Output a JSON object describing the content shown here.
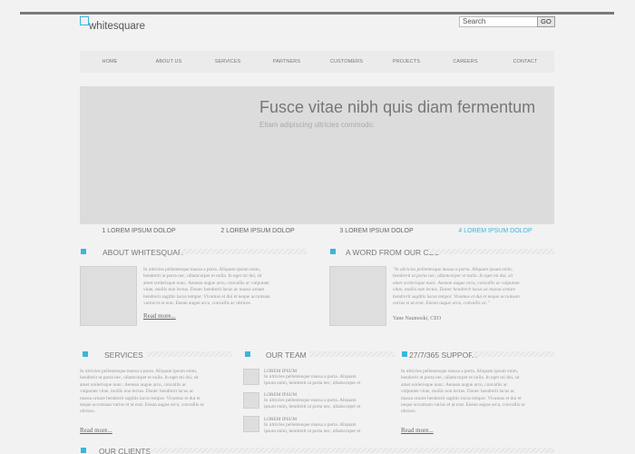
{
  "brand": {
    "logo_text": "whitesquare",
    "accent": "#3ab6dc"
  },
  "search": {
    "value": "Search",
    "button": "GO"
  },
  "nav": [
    "HOME",
    "ABOUT US",
    "SERVICES",
    "PARTNERS",
    "CUSTOMERS",
    "PROJECTS",
    "CAREERS",
    "CONTACT"
  ],
  "hero": {
    "title": "Fusce vitae nibh quis diam fermentum",
    "subtitle": "Etiam adipiscing ultricies commodo."
  },
  "slider_tabs": [
    "1 LOREM IPSUM DOLOP",
    "2 LOREM IPSUM DOLOP",
    "3 LOREM IPSUM DOLOP",
    "4 LOREM IPSUM DOLOP"
  ],
  "about": {
    "title": "ABOUT WHITESQUAR",
    "lines": [
      "In ultricies pellentesque massa a porta. Aliquam ipsum enim,",
      "hendrerit ut porta nec, ullamcorper et nulla. In eget mi dui, sit",
      "amet scelerisque nunc. Aenean augue arcu, convallis ac vulputate",
      "vitae, mollis non lectus. Donec hendrerit lacus ac massa ornare",
      "hendrerit sagittis lacus tempor. Vivamus et dui et neque accumsan",
      "varius et ut erat. Enean augue arcu, convallis ac ultrices."
    ],
    "read_more": "Read more..."
  },
  "ceo": {
    "title": "A WORD FROM OUR CEO",
    "lines": [
      "\"In ultricies pellentesque massa a porta. Aliquam ipsum enim,",
      "hendrerit ut porta nec, ullamcorper et nulla. In eget mi dui, sit",
      "amet scelerisque nunc. Aenean augue arcu, convallis ac vulputate",
      "vitae, mollis non lectus. Donec hendrerit lacus ac massa ornare",
      "hendrerit sagittis lacus tempor. Vivamus et dui et neque accumsan",
      "varius et ut erat. Enean augue arcu, convallis ac.\""
    ],
    "author": "Yane Naumoski, CEO"
  },
  "services": {
    "title": "SERVICES",
    "lines": [
      "In ultricies pellentesque massa a porta. Aliquam ipsum enim,",
      "hendrerit ut porta nec, ullamcorper et nulla. In eget mi dui, sit",
      "amet scelerisque nunc. Aenean augue arcu, convallis ac",
      "vulputate vitae, mollis non lectus. Donec hendrerit lacus ac",
      "massa ornare hendrerit sagittis lacus tempor. Vivamus et dui et",
      "neque accumsan varius et ut erat. Enean augue arcu, convallis ac",
      "ultrices."
    ],
    "read_more": "Read more..."
  },
  "team": {
    "title": "OUR TEAM",
    "members": [
      {
        "name": "LOREM IPSUM",
        "lines": [
          "In ultricies pellentesque massa a porta. Aliquam",
          "ipsum enim, hendrerit ut porta nec, ullamcorper et"
        ]
      },
      {
        "name": "LOREM IPSUM",
        "lines": [
          "In ultricies pellentesque massa a porta. Aliquam",
          "ipsum enim, hendrerit ut porta nec, ullamcorper et"
        ]
      },
      {
        "name": "LOREM IPSUM",
        "lines": [
          "In ultricies pellentesque massa a porta. Aliquam",
          "ipsum enim, hendrerit ut porta nec, ullamcorper et"
        ]
      }
    ]
  },
  "support": {
    "title": "27/7/365 SUPPORT",
    "lines": [
      "In ultricies pellentesque massa a porta. Aliquam ipsum enim,",
      "hendrerit ut porta nec, ullamcorper et nulla. In eget mi dui, sit",
      "amet scelerisque nunc. Aenean augue arcu, convallis ac",
      "vulputate vitae, mollis non lectus. Donec hendrerit lacus ac",
      "massa ornare hendrerit sagittis lacus tempor. Vivamus et dui et",
      "neque accumsan varius et ut erat. Enean augue arcu, convallis ac",
      "ultrices."
    ],
    "read_more": "Read more..."
  },
  "clients": {
    "title": "OUR CLIENTS"
  }
}
